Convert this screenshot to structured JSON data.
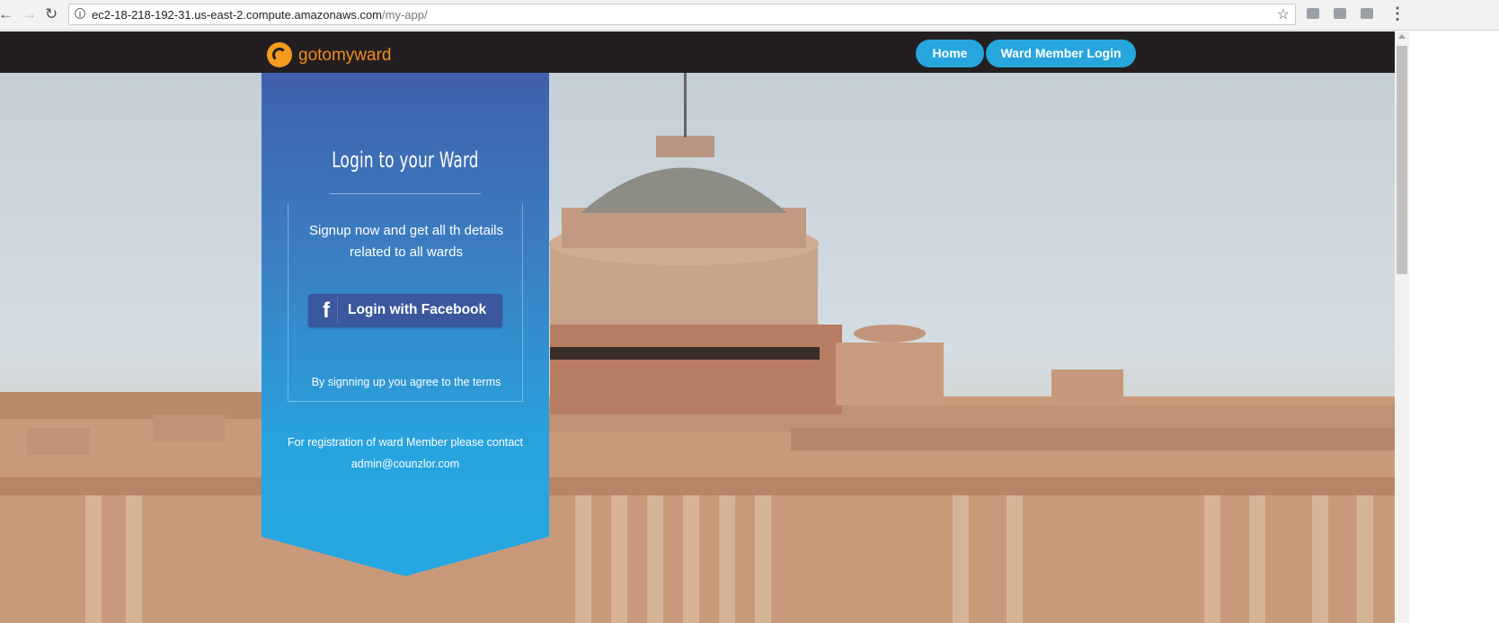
{
  "browser": {
    "back_icon": "back-arrow-icon",
    "forward_icon": "forward-arrow-icon",
    "reload_icon": "reload-icon",
    "url_host": "ec2-18-218-192-31.us-east-2.compute.amazonaws.com",
    "url_path": "/my-app/",
    "star_icon": "bookmark-star-icon",
    "menu_icon": "menu-dots-icon"
  },
  "header": {
    "logo_text": "gotomyward",
    "nav": [
      {
        "label": "Home"
      },
      {
        "label": "Ward Member Login"
      }
    ]
  },
  "login_panel": {
    "title": "Login to your Ward",
    "signup_text": "Signup now and get all th details related to all wards",
    "facebook_button": "Login with Facebook",
    "terms_text": "By signning up you agree to the terms",
    "contact_line1": "For registration of ward Member please contact",
    "contact_email": "admin@counzlor.com"
  },
  "colors": {
    "header_bg": "#231f20",
    "nav_pill": "#27a6dd",
    "logo_orange": "#f08a1c",
    "panel_top": "#4060ac",
    "panel_bottom": "#25a7e1",
    "facebook_blue": "#3b579d"
  }
}
